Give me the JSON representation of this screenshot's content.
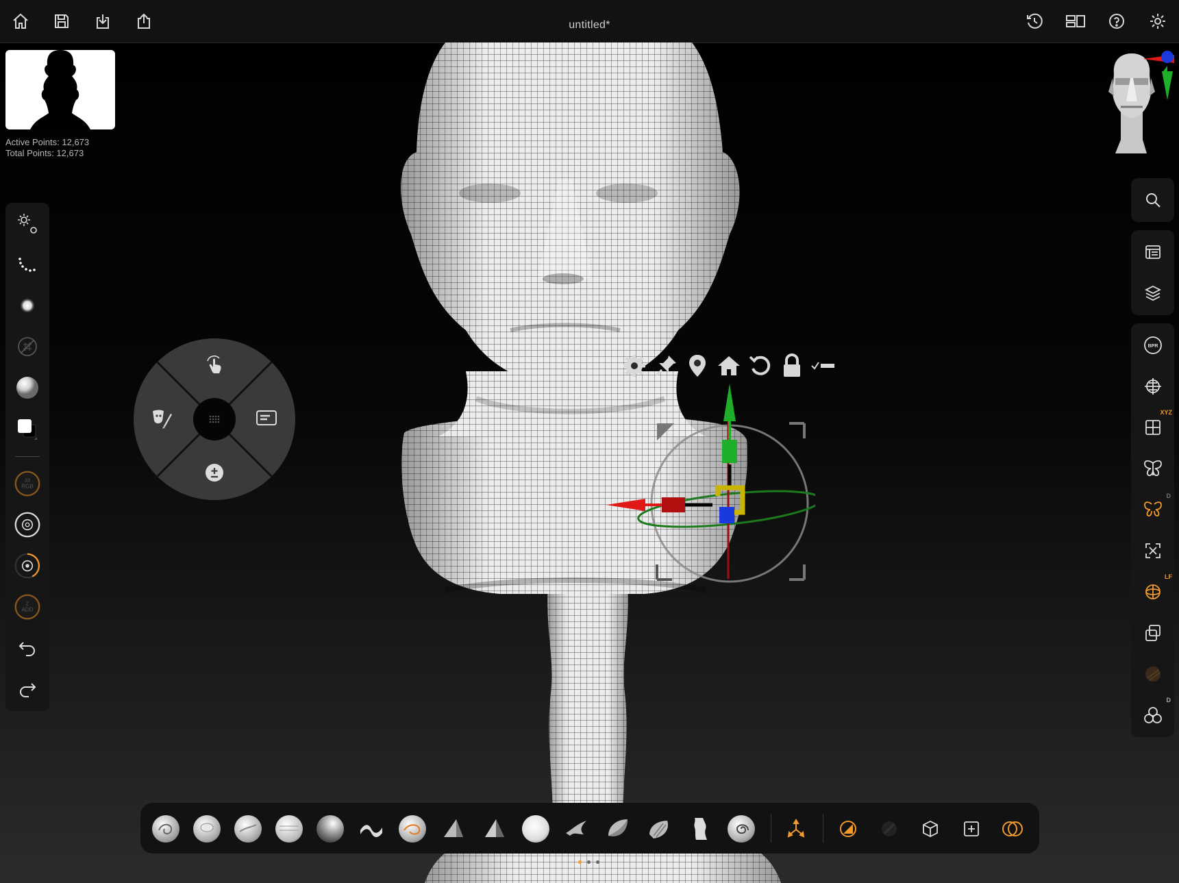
{
  "window": {
    "title": "untitled*"
  },
  "topbar": {
    "left_icons": [
      "home-icon",
      "save-icon",
      "import-icon",
      "share-icon"
    ],
    "right_icons": [
      "history-icon",
      "layout-icon",
      "help-icon",
      "settings-icon"
    ]
  },
  "stats": {
    "active_points": "Active Points: 12,673",
    "total_points": "Total Points: 12,673"
  },
  "left_toolbar": {
    "items": [
      "stroke-settings",
      "stroke-type",
      "alpha",
      "texture",
      "material",
      "color-swatch",
      "rgb-intensity",
      "draw-size",
      "focal-shift",
      "z-intensity",
      "undo",
      "redo"
    ],
    "rgb_label": "RGB",
    "rgb_value": "33",
    "zadd_label": "ADD",
    "zadd_value": "Z"
  },
  "right_toolbar": {
    "group1": [
      "search-icon"
    ],
    "group2": [
      "subtool-icon",
      "layers-icon"
    ],
    "group3": [
      "bpr-icon",
      "floor-grid-icon",
      "xyz-symmetry-icon",
      "symmetry-icon",
      "radial-symmetry-icon",
      "frame-icon",
      "local-transform-icon",
      "transparency-icon",
      "polyframe-icon",
      "solo-icon"
    ],
    "bpr_label": "BPR",
    "xyz_tag": "XYZ",
    "lf_tag": "LF",
    "d_tag": "D"
  },
  "colors": {
    "accent": "#f29a2e",
    "panel": "#161616",
    "axis_x": "#e01818",
    "axis_y": "#1fae2a",
    "axis_z": "#1a3ae0"
  },
  "bottom_shelf": {
    "brushes": [
      "ClayBuildup",
      "Standard",
      "Move",
      "Smooth",
      "DamStandard",
      "Inflate",
      "Pinch",
      "TrimDynamic",
      "hPolish",
      "Clay",
      "Snakehook",
      "Planar",
      "Slash",
      "Flatten",
      "Curve"
    ],
    "tools": [
      "gizmo-icon",
      "draw-mode-icon",
      "mask-icon",
      "dynamesh-icon",
      "zremesher-icon",
      "boolean-icon"
    ],
    "page_count": 3,
    "current_page": 1
  }
}
